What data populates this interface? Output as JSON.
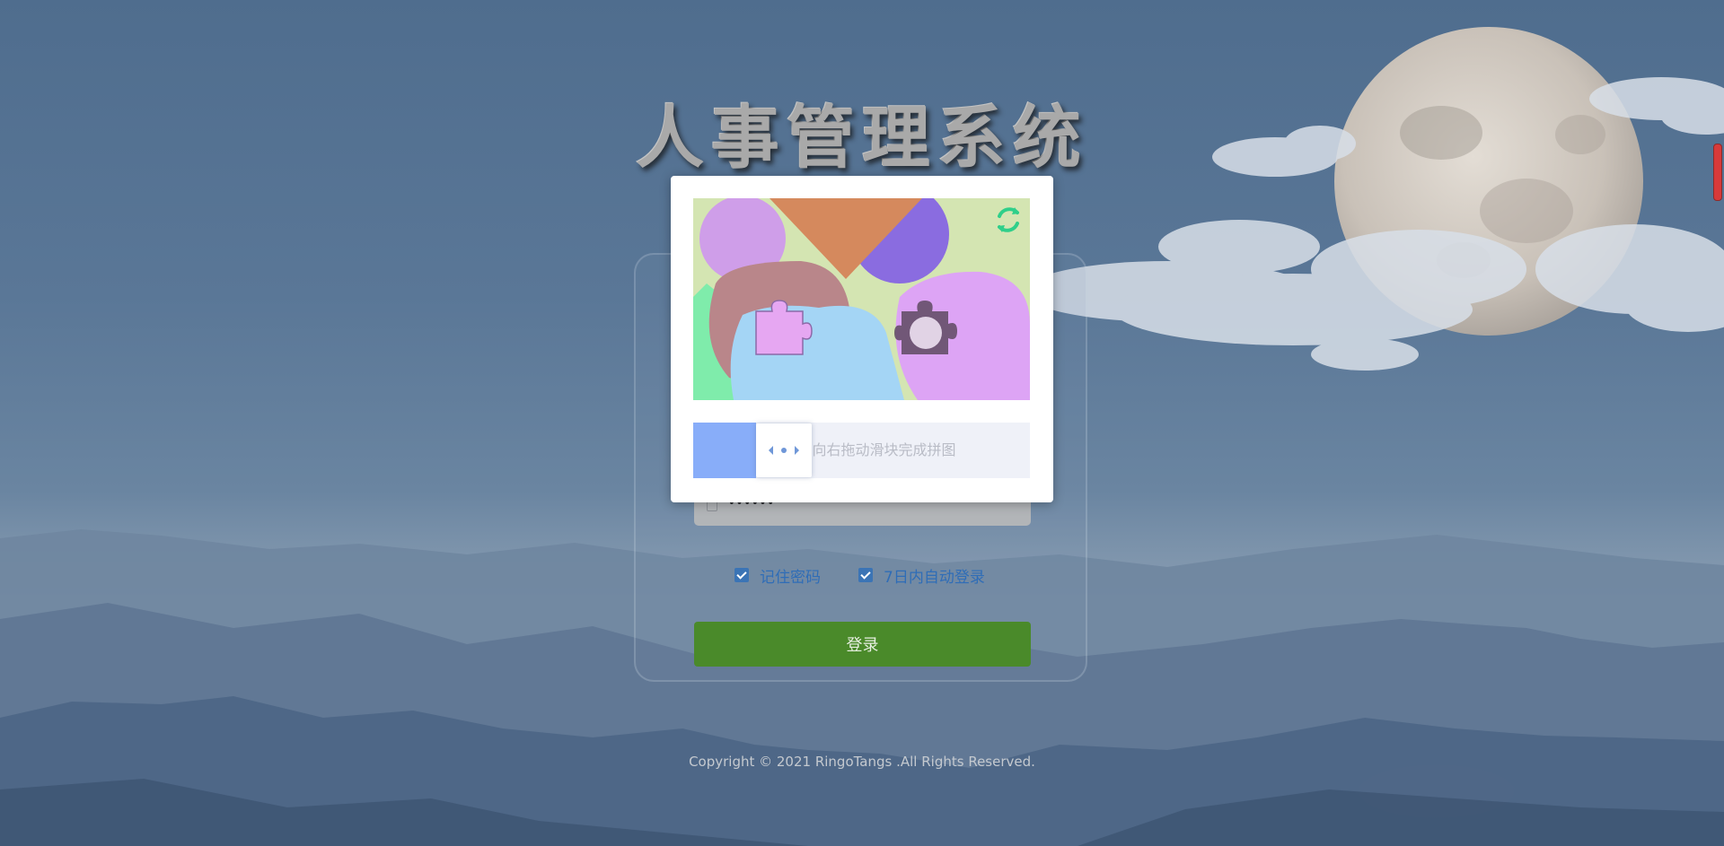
{
  "page": {
    "title": "人事管理系统",
    "copyright": "Copyright © 2021 RingoTangs .All Rights Reserved."
  },
  "login_form": {
    "password_value": "••••••",
    "remember_password_label": "记住密码",
    "auto_login_label": "7日内自动登录",
    "login_button_label": "登录",
    "remember_password_checked": true,
    "auto_login_checked": true
  },
  "captcha": {
    "slider_hint": "向右拖动滑块完成拼图",
    "refresh_icon": "refresh-icon",
    "slider_icon": "drag-arrows-icon",
    "slider_progress": 0.17
  },
  "colors": {
    "login_button": "#4a8a2a",
    "checkbox": "#3b74b5",
    "label_text": "#2f6db7",
    "slider_fill": "#88adf9",
    "refresh_icon": "#2fcf8a"
  }
}
